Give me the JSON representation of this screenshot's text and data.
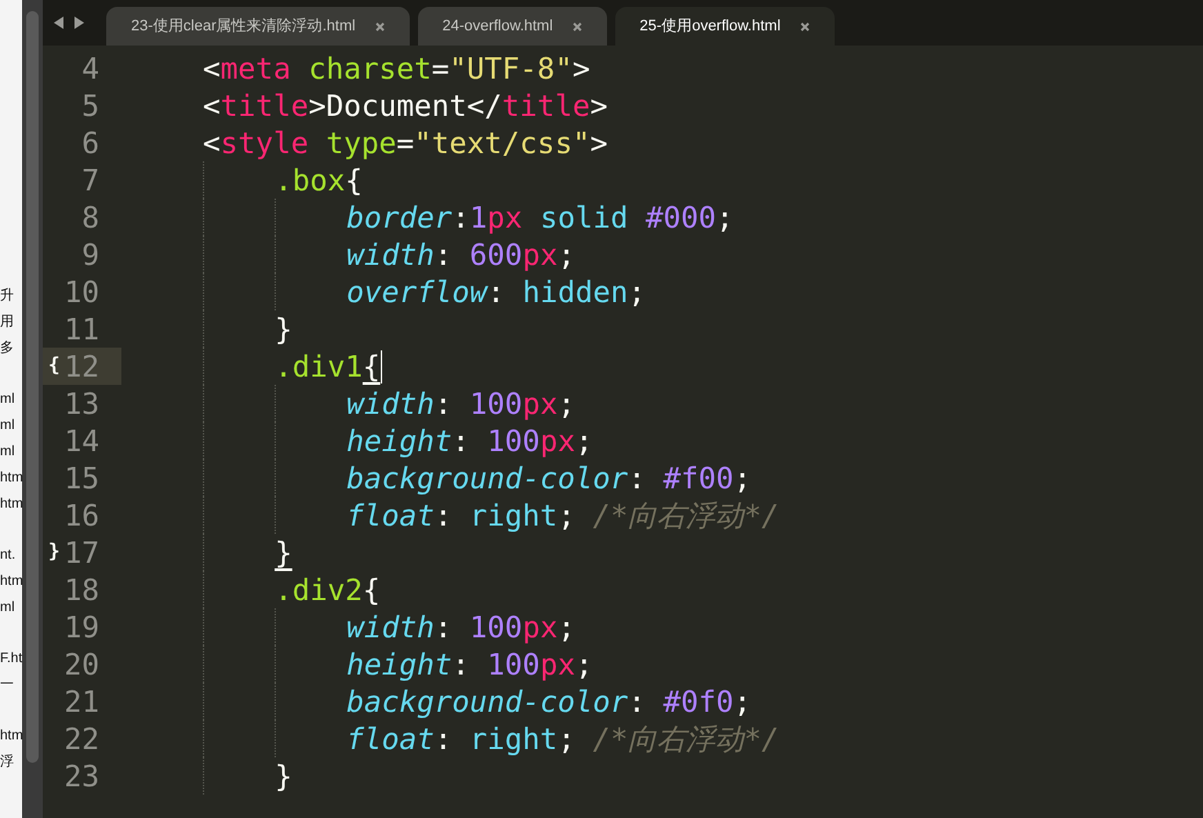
{
  "background_window": {
    "line_groups": [
      [
        "升",
        "用",
        "多"
      ],
      [
        "ml",
        "ml",
        "ml",
        "htm",
        "htm"
      ],
      [
        "nt.",
        "htm",
        "ml"
      ],
      [
        "F.ht",
        "一"
      ],
      [
        "htm",
        "浮"
      ]
    ]
  },
  "tab_bar": {
    "tabs": [
      {
        "label": "23-使用clear属性来清除浮动.html",
        "selected": false
      },
      {
        "label": "24-overflow.html",
        "selected": false
      },
      {
        "label": "25-使用overflow.html",
        "selected": true
      }
    ]
  },
  "editor": {
    "lines": [
      {
        "number": "4",
        "current": false,
        "code": "    <meta charset=\"UTF-8\">"
      },
      {
        "number": "5",
        "current": false,
        "code": "    <title>Document</title>"
      },
      {
        "number": "6",
        "current": false,
        "code": "    <style type=\"text/css\">"
      },
      {
        "number": "7",
        "current": false,
        "code": "        .box{"
      },
      {
        "number": "8",
        "current": false,
        "code": "            border:1px solid #000;"
      },
      {
        "number": "9",
        "current": false,
        "code": "            width: 600px;"
      },
      {
        "number": "10",
        "current": false,
        "code": "            overflow: hidden;"
      },
      {
        "number": "11",
        "current": false,
        "code": "        }"
      },
      {
        "number": "12",
        "current": true,
        "fold_mark": "{",
        "matched_bracket": true,
        "cursor": true,
        "code": "        .div1{"
      },
      {
        "number": "13",
        "current": false,
        "code": "            width: 100px;"
      },
      {
        "number": "14",
        "current": false,
        "code": "            height: 100px;"
      },
      {
        "number": "15",
        "current": false,
        "code": "            background-color: #f00;"
      },
      {
        "number": "16",
        "current": false,
        "code": "            float: right; /*向右浮动*/"
      },
      {
        "number": "17",
        "current": false,
        "fold_mark": "}",
        "matched_bracket": true,
        "code": "        }"
      },
      {
        "number": "18",
        "current": false,
        "code": "        .div2{"
      },
      {
        "number": "19",
        "current": false,
        "code": "            width: 100px;"
      },
      {
        "number": "20",
        "current": false,
        "code": "            height: 100px;"
      },
      {
        "number": "21",
        "current": false,
        "code": "            background-color: #0f0;"
      },
      {
        "number": "22",
        "current": false,
        "code": "            float: right; /*向右浮动*/"
      },
      {
        "number": "23",
        "current": false,
        "code": "        }"
      }
    ]
  }
}
